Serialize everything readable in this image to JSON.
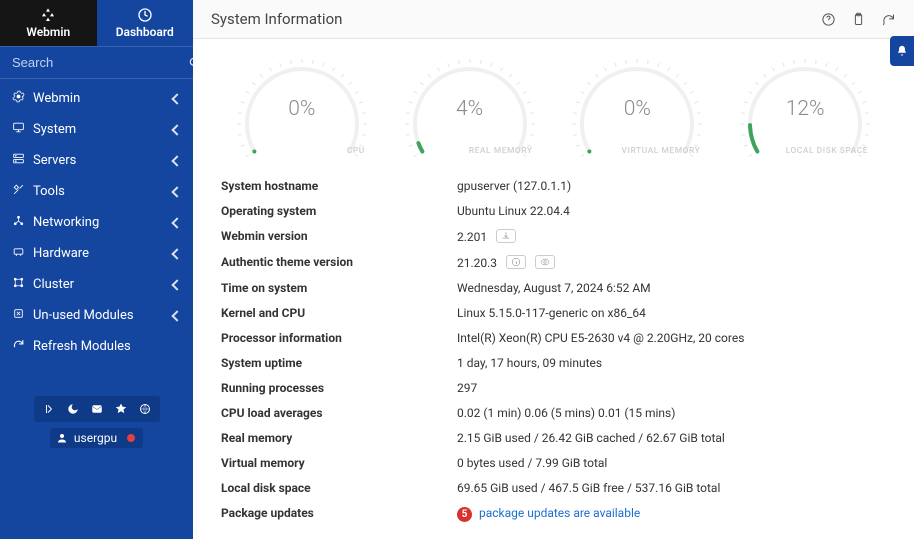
{
  "tabs": {
    "webmin": "Webmin",
    "dashboard": "Dashboard"
  },
  "search": {
    "placeholder": "Search"
  },
  "nav": [
    {
      "label": "Webmin"
    },
    {
      "label": "System"
    },
    {
      "label": "Servers"
    },
    {
      "label": "Tools"
    },
    {
      "label": "Networking"
    },
    {
      "label": "Hardware"
    },
    {
      "label": "Cluster"
    },
    {
      "label": "Un-used Modules"
    },
    {
      "label": "Refresh Modules"
    }
  ],
  "user": "usergpu",
  "panel": {
    "title": "System Information"
  },
  "gauges": [
    {
      "label": "CPU",
      "percent": "0%",
      "frac": 0
    },
    {
      "label": "REAL MEMORY",
      "percent": "4%",
      "frac": 0.04
    },
    {
      "label": "VIRTUAL MEMORY",
      "percent": "0%",
      "frac": 0
    },
    {
      "label": "LOCAL DISK SPACE",
      "percent": "12%",
      "frac": 0.12
    }
  ],
  "info": {
    "hostname_lbl": "System hostname",
    "hostname_val": "gpuserver (127.0.1.1)",
    "os_lbl": "Operating system",
    "os_val": "Ubuntu Linux 22.04.4",
    "webmin_ver_lbl": "Webmin version",
    "webmin_ver_val": "2.201",
    "theme_ver_lbl": "Authentic theme version",
    "theme_ver_val": "21.20.3",
    "time_lbl": "Time on system",
    "time_val": "Wednesday, August 7, 2024 6:52 AM",
    "kernel_lbl": "Kernel and CPU",
    "kernel_val": "Linux 5.15.0-117-generic on x86_64",
    "proc_lbl": "Processor information",
    "proc_val": "Intel(R) Xeon(R) CPU E5-2630 v4 @ 2.20GHz, 20 cores",
    "uptime_lbl": "System uptime",
    "uptime_val": "1 day, 17 hours, 09 minutes",
    "procs_lbl": "Running processes",
    "procs_val": "297",
    "load_lbl": "CPU load averages",
    "load_val": "0.02 (1 min) 0.06 (5 mins) 0.01 (15 mins)",
    "realmem_lbl": "Real memory",
    "realmem_val": "2.15 GiB used / 26.42 GiB cached / 62.67 GiB total",
    "virt_lbl": "Virtual memory",
    "virt_val": "0 bytes used / 7.99 GiB total",
    "disk_lbl": "Local disk space",
    "disk_val": "69.65 GiB used / 467.5 GiB free / 537.16 GiB total",
    "pkg_lbl": "Package updates",
    "pkg_count": "5",
    "pkg_msg": "package updates are available"
  }
}
